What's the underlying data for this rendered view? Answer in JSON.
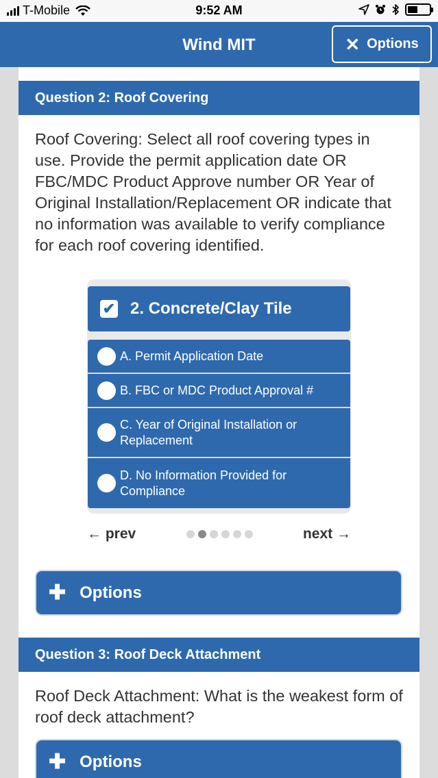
{
  "status_bar": {
    "carrier": "T-Mobile",
    "time": "9:52 AM",
    "battery_level": 0.45
  },
  "header": {
    "title": "Wind MIT",
    "options_label": "Options"
  },
  "question2": {
    "header": "Question 2: Roof Covering",
    "text": "Roof Covering: Select all roof covering types in use. Provide the permit application date OR FBC/MDC Product Approve number OR Year of Original Installation/Replacement OR indicate that no information was available to verify compliance for each roof covering identified.",
    "card": {
      "title": "2. Concrete/Clay Tile",
      "checked": true,
      "options": [
        {
          "label": "A. Permit Application Date"
        },
        {
          "label": "B. FBC or MDC Product Approval #"
        },
        {
          "label": "C. Year of Original Installation or Replacement"
        },
        {
          "label": "D. No Information Provided for Compliance"
        }
      ]
    },
    "pager": {
      "prev": "← prev",
      "next": "next →",
      "page_count": 6,
      "current_page": 2
    },
    "options_label": "Options"
  },
  "question3": {
    "header": "Question 3: Roof Deck Attachment",
    "text": "Roof Deck Attachment: What is the weakest form of roof deck attachment?",
    "options_label": "Options"
  },
  "colors": {
    "primary": "#2f69ad",
    "background": "#dcdcdc"
  }
}
